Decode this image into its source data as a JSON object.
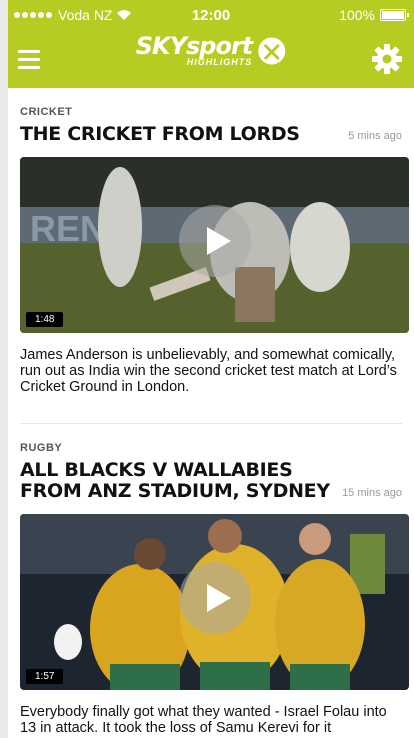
{
  "status_bar": {
    "carrier": "Voda NZ",
    "time": "12:00",
    "battery": "100%",
    "battery_level": 1.0
  },
  "header": {
    "logo_text": "SKYsport",
    "logo_sub": "HIGHLIGHTS",
    "menu_icon": "hamburger-menu-icon",
    "settings_icon": "gear-icon",
    "color": "#b7cc22"
  },
  "articles": [
    {
      "category": "CRICKET",
      "title_lines": [
        "THE CRICKET FROM LORDS"
      ],
      "time_ago": "5 mins ago",
      "duration": "1:48",
      "description": "James Anderson is unbelievably, and somewhat comically, run out as India win the second cricket test match at Lord’s Cricket Ground in London."
    },
    {
      "category": "RUGBY",
      "title_lines": [
        "ALL BLACKS V WALLABIES",
        "FROM ANZ STADIUM, SYDNEY"
      ],
      "time_ago": "15 mins ago",
      "duration": "1:57",
      "description": "Everybody finally got what they wanted - Israel Folau into 13 in attack. It took the loss of Samu Kerevi for it"
    }
  ]
}
